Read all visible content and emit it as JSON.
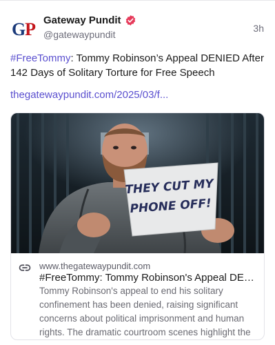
{
  "author": {
    "avatar_letters_1": "G",
    "avatar_letters_2": "P",
    "display_name": "Gateway Pundit",
    "handle": "@gatewaypundit",
    "verified_icon": "verified-badge-icon",
    "timestamp": "3h"
  },
  "post": {
    "hashtag": "#FreeTommy",
    "text": ": Tommy Robinson’s Appeal DENIED After 142 Days of Solitary Torture for Free Speech",
    "link": "thegatewaypundit.com/2025/03/f..."
  },
  "card": {
    "image_sign_line1": "THEY CUT MY",
    "image_sign_line2": "PHONE OFF!",
    "icon": "link-icon",
    "domain": "www.thegatewaypundit.com",
    "title": "#FreeTommy: Tommy Robinson's Appeal DENI...",
    "description": "Tommy Robinson's appeal to end his solitary confinement has been denied, raising significant concerns about political imprisonment and human rights. The dramatic courtroom scenes highlight the tr..."
  },
  "colors": {
    "accent": "#5a4fcf",
    "verified": "#e63a5a",
    "brand_blue": "#1b3a7a",
    "brand_red": "#c4161c"
  }
}
